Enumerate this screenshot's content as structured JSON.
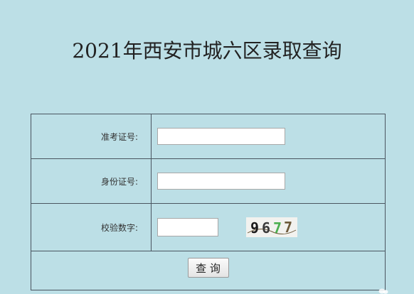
{
  "page": {
    "title": "2021年西安市城六区录取查询"
  },
  "form": {
    "exam_id": {
      "label": "准考证号:",
      "value": "",
      "placeholder": ""
    },
    "id_number": {
      "label": "身份证号:",
      "value": "",
      "placeholder": ""
    },
    "verify_code": {
      "label": "校验数字:",
      "value": "",
      "placeholder": "",
      "captcha_text": "9677"
    },
    "submit_label": "查 询"
  },
  "colors": {
    "background": "#bcdfe6",
    "border": "#4a5560",
    "captcha_digit_1": "#1a1a1a",
    "captcha_digit_2": "#3a3a3a",
    "captcha_digit_3": "#4caf50",
    "captcha_digit_4": "#6d5a3a"
  },
  "icons": {
    "watermark": "wechat-watermark-icon"
  }
}
